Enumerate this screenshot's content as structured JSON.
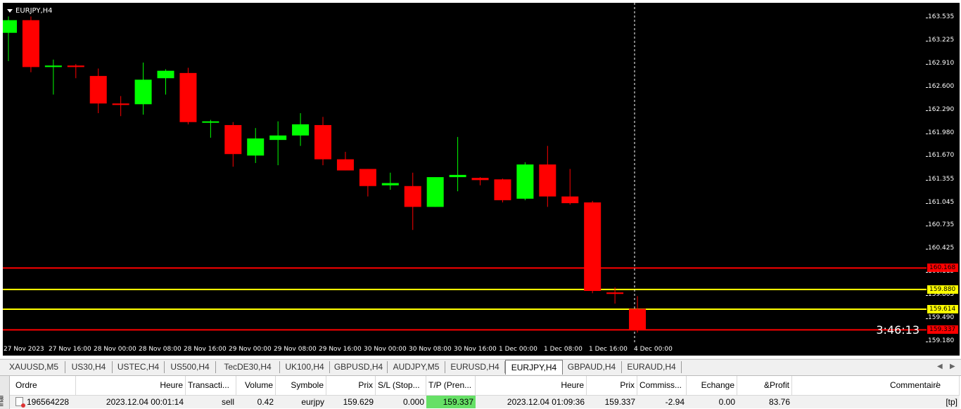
{
  "chart": {
    "title": "EURJPY,H4",
    "countdown": "3:46:13",
    "price_ticks": [
      "163.535",
      "163.225",
      "162.910",
      "162.600",
      "162.290",
      "161.980",
      "161.670",
      "161.355",
      "161.045",
      "160.735",
      "160.425",
      "160.115",
      "159.805",
      "159.490",
      "159.180"
    ],
    "time_ticks": [
      "27 Nov 2023",
      "27 Nov 16:00",
      "28 Nov 00:00",
      "28 Nov 08:00",
      "28 Nov 16:00",
      "29 Nov 00:00",
      "29 Nov 08:00",
      "29 Nov 16:00",
      "30 Nov 00:00",
      "30 Nov 08:00",
      "30 Nov 16:00",
      "1 Dec 00:00",
      "1 Dec 08:00",
      "1 Dec 16:00",
      "4 Dec 00:00"
    ],
    "levels": [
      {
        "price": "160.168",
        "color": "#ff0000",
        "label_bg": "#ff0000",
        "label_color": "#000000"
      },
      {
        "price": "159.880",
        "color": "#ffff00",
        "label_bg": "#ffff00",
        "label_color": "#000000"
      },
      {
        "price": "159.614",
        "color": "#ffff00",
        "label_bg": "#ffff00",
        "label_color": "#000000"
      },
      {
        "price": "159.337",
        "color": "#ff0000",
        "label_bg": "#ff0000",
        "label_color": "#000000"
      }
    ],
    "bull_color": "#00ff00",
    "bear_color": "#ff0000"
  },
  "chart_data": {
    "type": "candlestick",
    "symbol": "EURJPY",
    "timeframe": "H4",
    "ylim": [
      159.18,
      163.535
    ],
    "candles": [
      {
        "o": 163.33,
        "h": 163.55,
        "l": 162.95,
        "c": 163.5
      },
      {
        "o": 163.5,
        "h": 163.55,
        "l": 162.8,
        "c": 162.87
      },
      {
        "o": 162.87,
        "h": 162.97,
        "l": 162.5,
        "c": 162.89
      },
      {
        "o": 162.89,
        "h": 162.91,
        "l": 162.72,
        "c": 162.87
      },
      {
        "o": 162.75,
        "h": 162.85,
        "l": 162.25,
        "c": 162.38
      },
      {
        "o": 162.38,
        "h": 162.48,
        "l": 162.21,
        "c": 162.36
      },
      {
        "o": 162.37,
        "h": 162.93,
        "l": 162.23,
        "c": 162.7
      },
      {
        "o": 162.72,
        "h": 162.84,
        "l": 162.5,
        "c": 162.82
      },
      {
        "o": 162.79,
        "h": 162.86,
        "l": 162.1,
        "c": 162.13
      },
      {
        "o": 162.13,
        "h": 162.16,
        "l": 161.92,
        "c": 162.14
      },
      {
        "o": 162.09,
        "h": 162.13,
        "l": 161.53,
        "c": 161.7
      },
      {
        "o": 161.68,
        "h": 162.05,
        "l": 161.58,
        "c": 161.91
      },
      {
        "o": 161.89,
        "h": 162.14,
        "l": 161.55,
        "c": 161.95
      },
      {
        "o": 161.95,
        "h": 162.25,
        "l": 161.81,
        "c": 162.1
      },
      {
        "o": 162.09,
        "h": 162.2,
        "l": 161.55,
        "c": 161.63
      },
      {
        "o": 161.63,
        "h": 161.73,
        "l": 161.48,
        "c": 161.48
      },
      {
        "o": 161.5,
        "h": 161.5,
        "l": 161.13,
        "c": 161.27
      },
      {
        "o": 161.28,
        "h": 161.45,
        "l": 161.22,
        "c": 161.31
      },
      {
        "o": 161.27,
        "h": 161.45,
        "l": 160.68,
        "c": 160.99
      },
      {
        "o": 160.99,
        "h": 161.37,
        "l": 160.99,
        "c": 161.39
      },
      {
        "o": 161.39,
        "h": 161.93,
        "l": 161.2,
        "c": 161.42
      },
      {
        "o": 161.38,
        "h": 161.39,
        "l": 161.28,
        "c": 161.35
      },
      {
        "o": 161.36,
        "h": 161.37,
        "l": 161.05,
        "c": 161.08
      },
      {
        "o": 161.1,
        "h": 161.59,
        "l": 161.08,
        "c": 161.56
      },
      {
        "o": 161.56,
        "h": 161.81,
        "l": 160.99,
        "c": 161.13
      },
      {
        "o": 161.13,
        "h": 161.5,
        "l": 161.02,
        "c": 161.04
      },
      {
        "o": 161.05,
        "h": 161.07,
        "l": 159.83,
        "c": 159.86
      },
      {
        "o": 159.84,
        "h": 159.91,
        "l": 159.69,
        "c": 159.82
      },
      {
        "o": 159.62,
        "h": 159.79,
        "l": 159.3,
        "c": 159.34
      }
    ]
  },
  "tabs": {
    "items": [
      "XAUUSD,M5",
      "US30,H4",
      "USTEC,H4",
      "US500,H4",
      "TecDE30,H4",
      "UK100,H4",
      "GBPUSD,H4",
      "AUDJPY,M5",
      "EURUSD,H4",
      "EURJPY,H4",
      "GBPAUD,H4",
      "EURAUD,H4"
    ],
    "active": "EURJPY,H4",
    "left_arrow": "◀",
    "right_arrow": "▶"
  },
  "terminal": {
    "side_label": "inal",
    "columns": [
      "Ordre",
      "Heure",
      "Transacti...",
      "Volume",
      "Symbole",
      "Prix",
      "S/L (Stop...",
      "T/P (Pren...",
      "Heure",
      "Prix",
      "Commiss...",
      "Echange",
      "&Profit",
      "Commentaire"
    ],
    "sort_marker": "/",
    "row": {
      "order": "196564228",
      "time": "2023.12.04 00:01:14",
      "type": "sell",
      "volume": "0.42",
      "symbol": "eurjpy",
      "price": "159.629",
      "sl": "0.000",
      "tp": "159.337",
      "time2": "2023.12.04 01:09:36",
      "price2": "159.337",
      "commission": "-2.94",
      "swap": "0.00",
      "profit": "83.76",
      "comment": "[tp]"
    }
  }
}
